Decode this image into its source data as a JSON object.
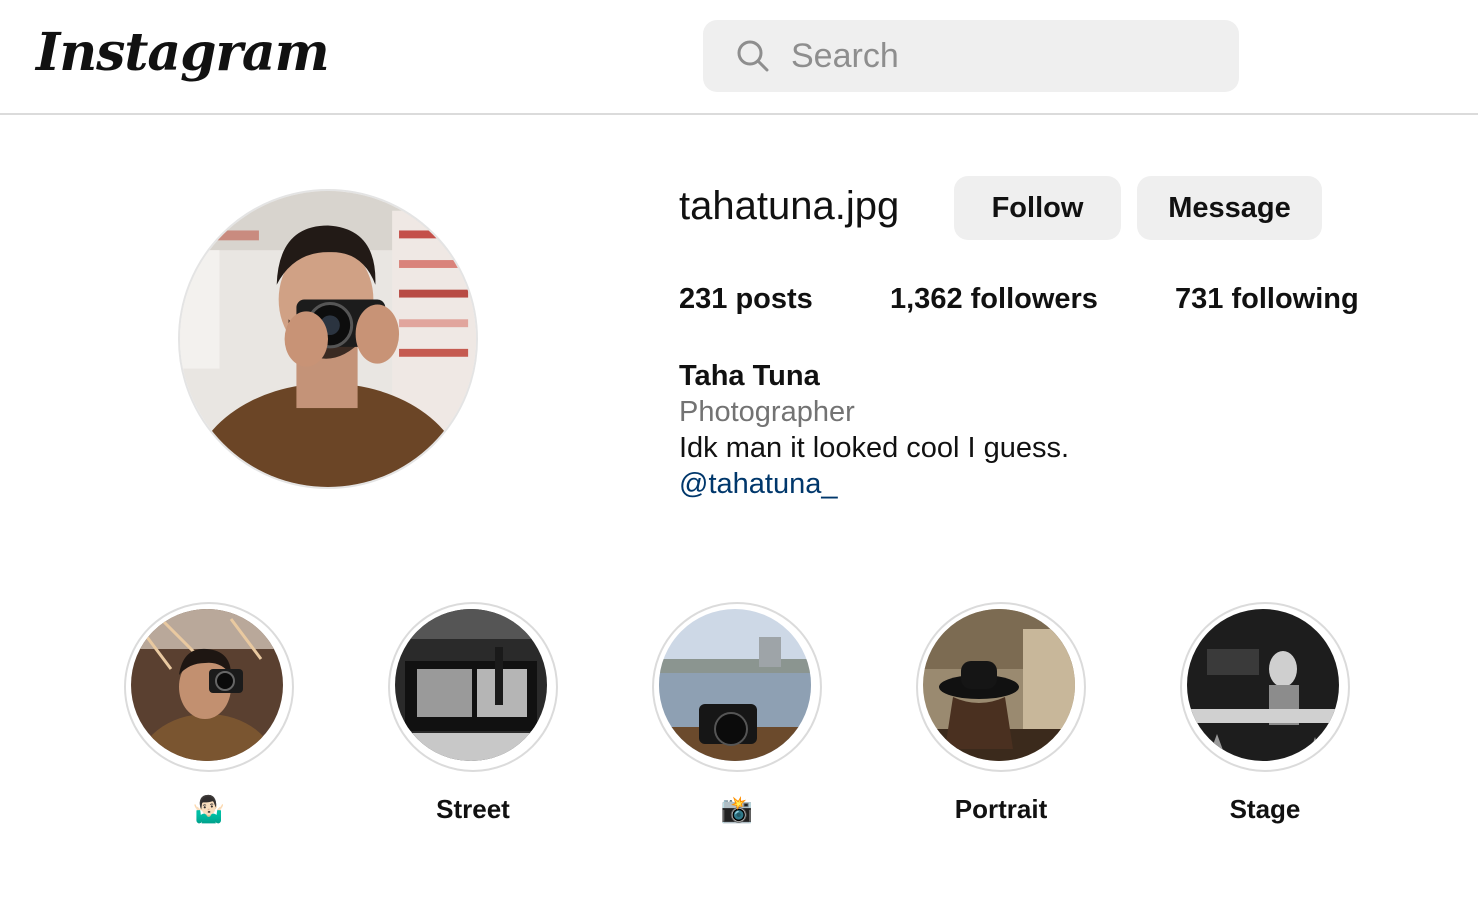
{
  "header": {
    "logo_text": "Instagram",
    "search": {
      "placeholder": "Search",
      "value": ""
    }
  },
  "profile": {
    "username": "tahatuna.jpg",
    "follow_label": "Follow",
    "message_label": "Message",
    "stats": {
      "posts_count": "231",
      "posts_label": "posts",
      "followers_count": "1,362",
      "followers_label": "followers",
      "following_count": "731",
      "following_label": "following"
    },
    "full_name": "Taha Tuna",
    "category": "Photographer",
    "bio": "Idk man it looked cool I guess.",
    "mention": "@tahatuna_"
  },
  "highlights": [
    {
      "label": "🤷🏻‍♂️"
    },
    {
      "label": "Street"
    },
    {
      "label": "📸"
    },
    {
      "label": "Portrait"
    },
    {
      "label": "Stage"
    }
  ],
  "colors": {
    "link": "#00376b",
    "button_bg": "#efefef",
    "muted_text": "#737373",
    "border": "#dbdbdb"
  }
}
